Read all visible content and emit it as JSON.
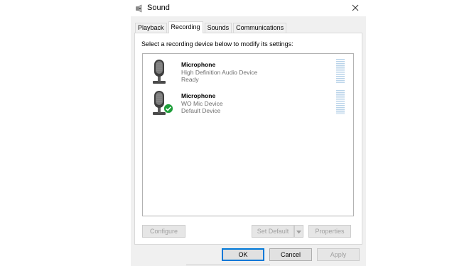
{
  "window": {
    "title": "Sound",
    "title_icon": "speaker-icon",
    "close_icon": "close-icon"
  },
  "tabs": [
    {
      "label": "Playback",
      "active": false
    },
    {
      "label": "Recording",
      "active": true
    },
    {
      "label": "Sounds",
      "active": false
    },
    {
      "label": "Communications",
      "active": false
    }
  ],
  "instruction": "Select a recording device below to modify its settings:",
  "devices": [
    {
      "name": "Microphone",
      "description": "High Definition Audio Device",
      "status": "Ready",
      "icon": "microphone-icon",
      "is_default": false
    },
    {
      "name": "Microphone",
      "description": "WO Mic Device",
      "status": "Default Device",
      "icon": "microphone-icon",
      "badge_icon": "checkmark-icon",
      "is_default": true
    }
  ],
  "buttons": {
    "configure": "Configure",
    "set_default": "Set Default",
    "properties": "Properties",
    "ok": "OK",
    "cancel": "Cancel",
    "apply": "Apply"
  },
  "colors": {
    "accent": "#0078d7",
    "default_badge": "#1e9e3a",
    "level_meter": "#b9d3e9",
    "disabled_text": "#a0a0a0"
  }
}
